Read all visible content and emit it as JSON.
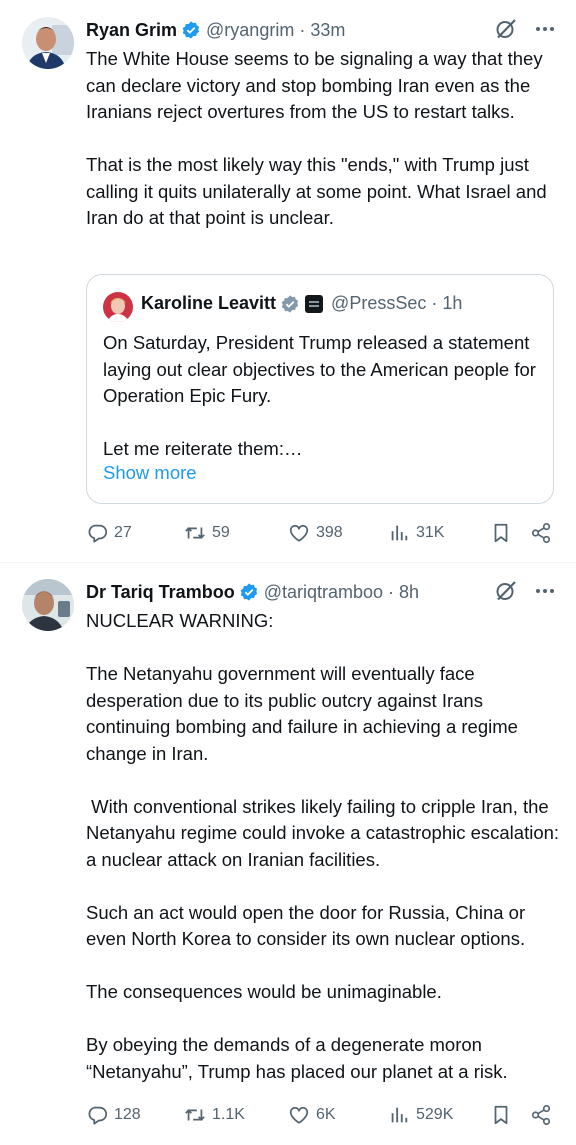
{
  "tweets": [
    {
      "author": "Ryan Grim",
      "handle": "@ryangrim",
      "time": "33m",
      "text": "The White House seems to be signaling a way that they can declare victory and stop bombing Iran even as the Iranians reject overtures from the US to restart talks.\n\nThat is the most likely way this \"ends,\" with Trump just calling it quits unilaterally at some point. What Israel and Iran do at that point is unclear.",
      "quote": {
        "author": "Karoline Leavitt",
        "handle": "@PressSec",
        "time": "1h",
        "text": "On Saturday, President Trump released a statement laying out clear objectives to the American people for Operation Epic Fury.\n\nLet me reiterate them:…",
        "show_more": "Show more"
      },
      "stats": {
        "replies": "27",
        "retweets": "59",
        "likes": "398",
        "views": "31K"
      }
    },
    {
      "author": "Dr Tariq Tramboo",
      "handle": "@tariqtramboo",
      "time": "8h",
      "text": "NUCLEAR WARNING:\n\nThe Netanyahu government will eventually face desperation due to its public outcry against Irans continuing bombing and failure in achieving a regime change in Iran.\n\n With conventional strikes likely failing to cripple Iran, the Netanyahu regime could invoke a catastrophic escalation: a nuclear attack on Iranian facilities.\n\nSuch an act would open the door for Russia, China or even North Korea to consider its own nuclear options.\n\nThe consequences would be unimaginable.\n\nBy obeying the demands of a degenerate moron “Netanyahu”, Trump has placed our planet at a risk.",
      "stats": {
        "replies": "128",
        "retweets": "1.1K",
        "likes": "6K",
        "views": "529K"
      }
    }
  ],
  "colors": {
    "text": "#0f1419",
    "secondary": "#536471",
    "accent": "#1d9bf0",
    "border": "#cfd9de"
  },
  "icons": [
    "verified-badge-icon",
    "grok-icon",
    "more-icon",
    "reply-icon",
    "retweet-icon",
    "like-icon",
    "views-icon",
    "bookmark-icon",
    "share-icon"
  ]
}
